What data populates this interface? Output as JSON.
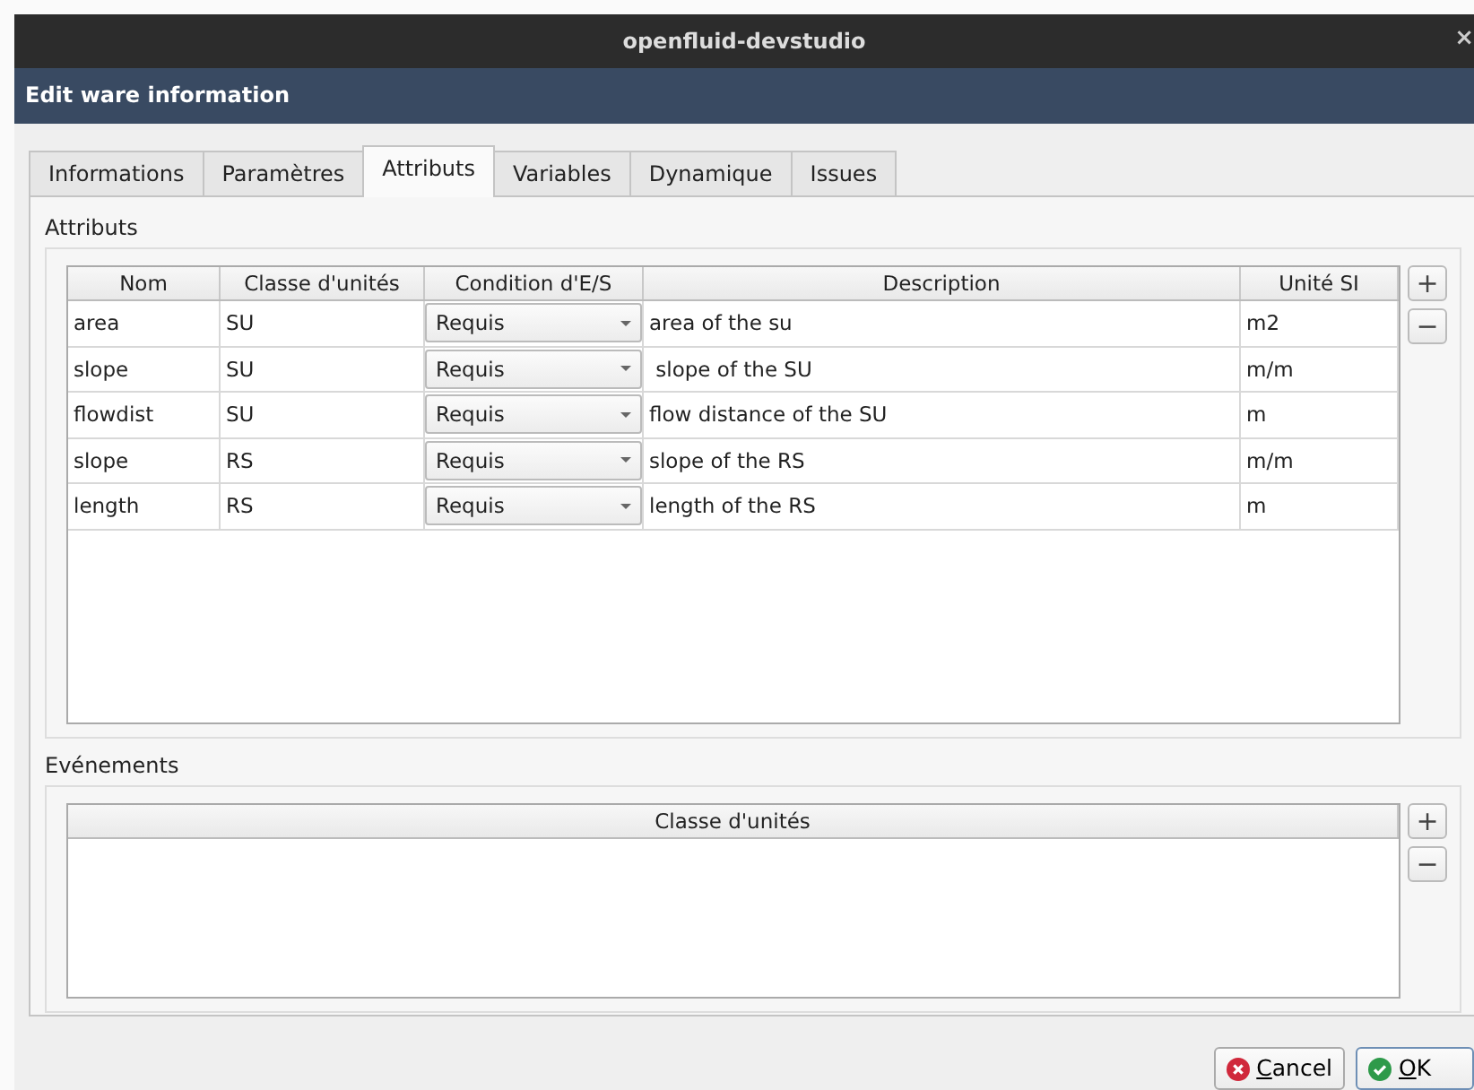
{
  "window": {
    "title": "openfluid-devstudio",
    "close": "×"
  },
  "header": {
    "title": "Edit ware information"
  },
  "tabs": [
    {
      "label": "Informations",
      "selected": false
    },
    {
      "label": "Paramètres",
      "selected": false
    },
    {
      "label": "Attributs",
      "selected": true
    },
    {
      "label": "Variables",
      "selected": false
    },
    {
      "label": "Dynamique",
      "selected": false
    },
    {
      "label": "Issues",
      "selected": false
    }
  ],
  "attributes": {
    "title": "Attributs",
    "columns": [
      "Nom",
      "Classe d'unités",
      "Condition d'E/S",
      "Description",
      "Unité SI"
    ],
    "rows": [
      {
        "name": "area",
        "unit_class": "SU",
        "condition": "Requis",
        "description": "area of the su",
        "si_unit": "m2"
      },
      {
        "name": "slope",
        "unit_class": "SU",
        "condition": "Requis",
        "description": " slope of the SU",
        "si_unit": "m/m"
      },
      {
        "name": "flowdist",
        "unit_class": "SU",
        "condition": "Requis",
        "description": "flow distance of the SU",
        "si_unit": "m"
      },
      {
        "name": "slope",
        "unit_class": "RS",
        "condition": "Requis",
        "description": "slope of the RS",
        "si_unit": "m/m"
      },
      {
        "name": "length",
        "unit_class": "RS",
        "condition": "Requis",
        "description": "length of the RS",
        "si_unit": "m"
      }
    ],
    "add": "+",
    "remove": "−"
  },
  "events": {
    "title": "Evénements",
    "columns": [
      "Classe d'unités"
    ],
    "add": "+",
    "remove": "−"
  },
  "buttons": [
    {
      "kind": "cancel",
      "label": "Cancel"
    },
    {
      "kind": "ok",
      "label": "OK"
    }
  ]
}
